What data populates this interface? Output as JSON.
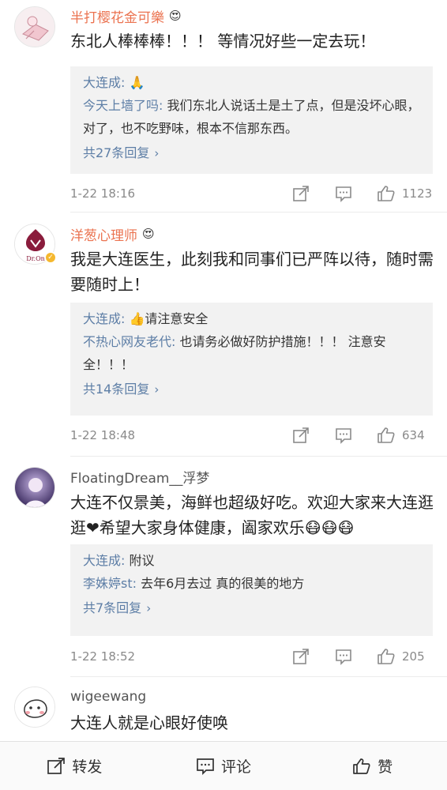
{
  "comments": [
    {
      "username": "半打樱花金可樂",
      "badge": "😍",
      "text": "东北人棒棒棒！！！ 等情况好些一定去玩！",
      "replies": [
        {
          "name": "大连成:",
          "text": " 🙏"
        },
        {
          "name": "今天上墙了吗:",
          "text": " 我们东北人说话土是土了点，但是没坏心眼，对了，也不吃野味，根本不信那东西。"
        }
      ],
      "more": "共27条回复",
      "time": "1-22 18:16",
      "likes": "1123"
    },
    {
      "username": "洋葱心理师",
      "badge": "😍",
      "text": "我是大连医生，此刻我和同事们已严阵以待，随时需要随时上！",
      "replies": [
        {
          "name": "大连成:",
          "text": " 👍请注意安全"
        },
        {
          "name": "不热心网友老代:",
          "text": " 也请务必做好防护措施！！！ 注意安全！！！"
        }
      ],
      "more": "共14条回复",
      "time": "1-22 18:48",
      "likes": "634"
    },
    {
      "username": "FloatingDream__浮梦",
      "text": "大连不仅景美，海鲜也超级好吃。欢迎大家来大连逛逛❤希望大家身体健康，阖家欢乐😷😷😷",
      "replies": [
        {
          "name": "大连成:",
          "text": " 附议"
        },
        {
          "name": "李姝婷st:",
          "text": " 去年6月去过 真的很美的地方"
        }
      ],
      "more": "共7条回复",
      "time": "1-22 18:52",
      "likes": "205"
    },
    {
      "username": "wigeewang",
      "text": "大连人就是心眼好使唤"
    }
  ],
  "avatars": {
    "onion_label": "Dr.On"
  },
  "bottom_bar": {
    "repost": "转发",
    "comment": "评论",
    "like": "赞"
  },
  "colors": {
    "link": "#5d7ea6",
    "name_vip": "#eb7350",
    "reply_bg": "#f2f2f2"
  }
}
